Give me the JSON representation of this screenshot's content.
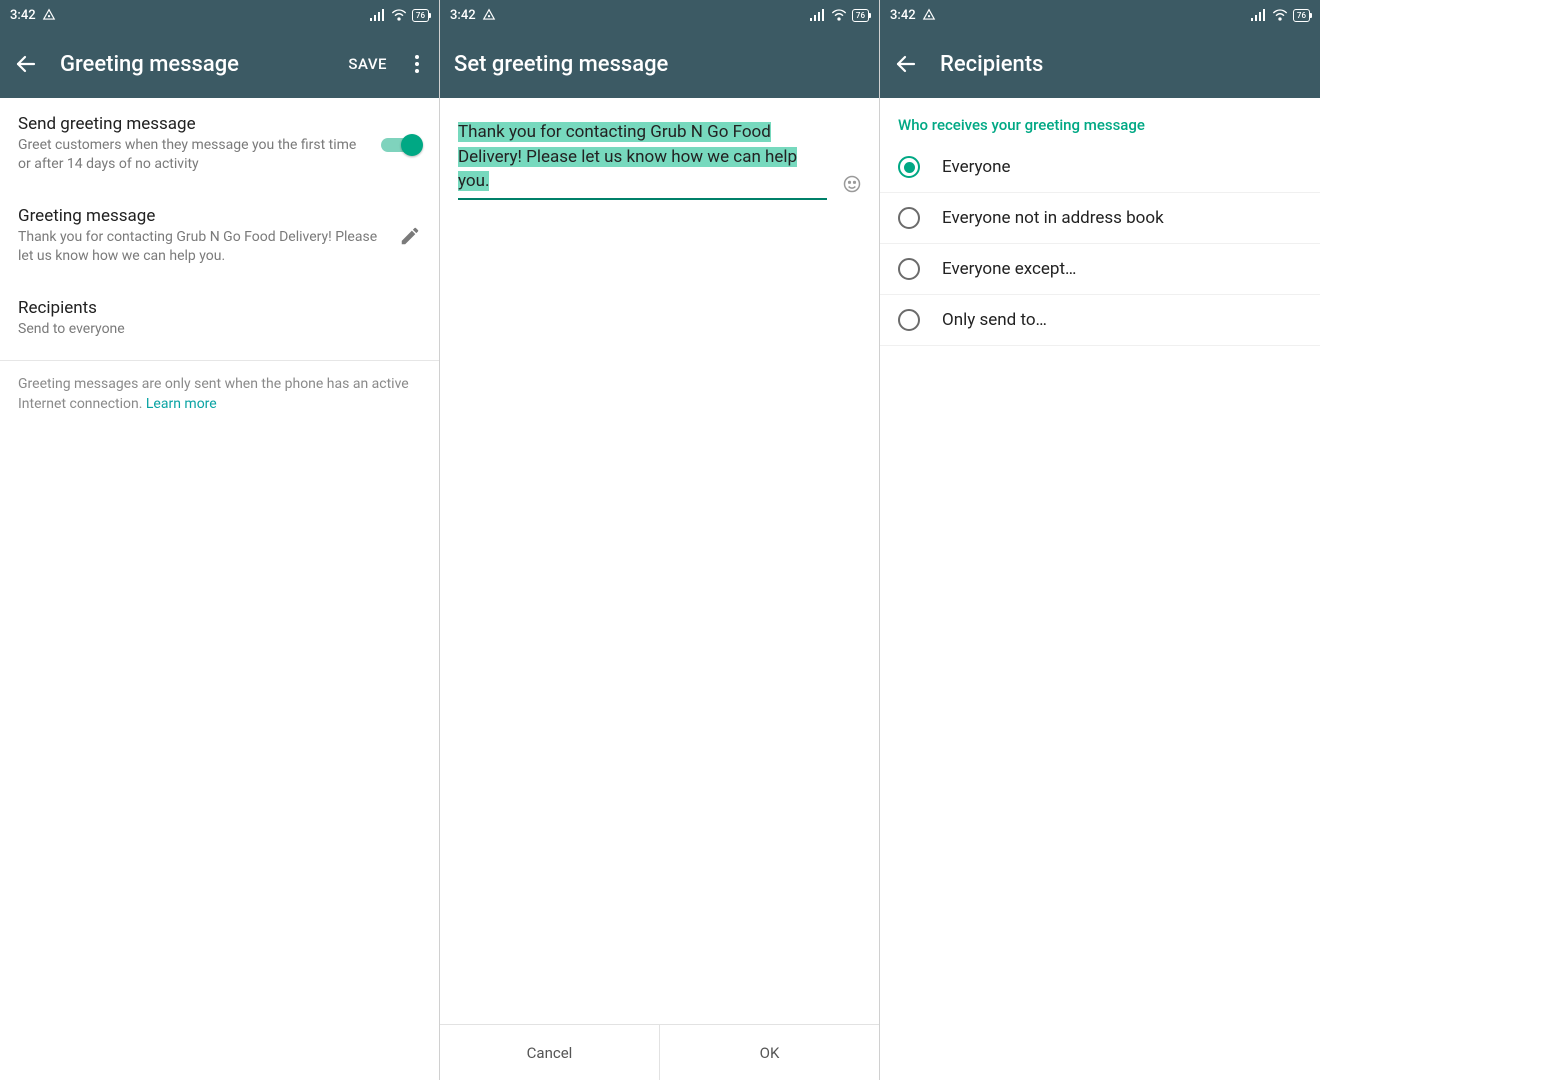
{
  "status": {
    "time": "3:42",
    "battery": "76"
  },
  "colors": {
    "accent": "#00a884",
    "header": "#3C5A64"
  },
  "panel1": {
    "title": "Greeting message",
    "save": "SAVE",
    "toggle": {
      "title": "Send greeting message",
      "subtitle": "Greet customers when they message you the first time or after 14 days of no activity"
    },
    "message": {
      "title": "Greeting message",
      "body": "Thank you for contacting Grub N Go Food Delivery! Please let us know how we can help you."
    },
    "recipients": {
      "title": "Recipients",
      "subtitle": "Send to everyone"
    },
    "footer": {
      "text": "Greeting messages are only sent when the phone has an active Internet connection. ",
      "link": "Learn more"
    }
  },
  "panel2": {
    "title": "Set greeting message",
    "text": "Thank you for contacting Grub N Go Food Delivery! Please let us know how we can help you.",
    "cancel": "Cancel",
    "ok": "OK"
  },
  "panel3": {
    "title": "Recipients",
    "header": "Who receives your greeting message",
    "options": [
      {
        "label": "Everyone",
        "checked": true
      },
      {
        "label": "Everyone not in address book",
        "checked": false
      },
      {
        "label": "Everyone except…",
        "checked": false
      },
      {
        "label": "Only send to…",
        "checked": false
      }
    ]
  }
}
